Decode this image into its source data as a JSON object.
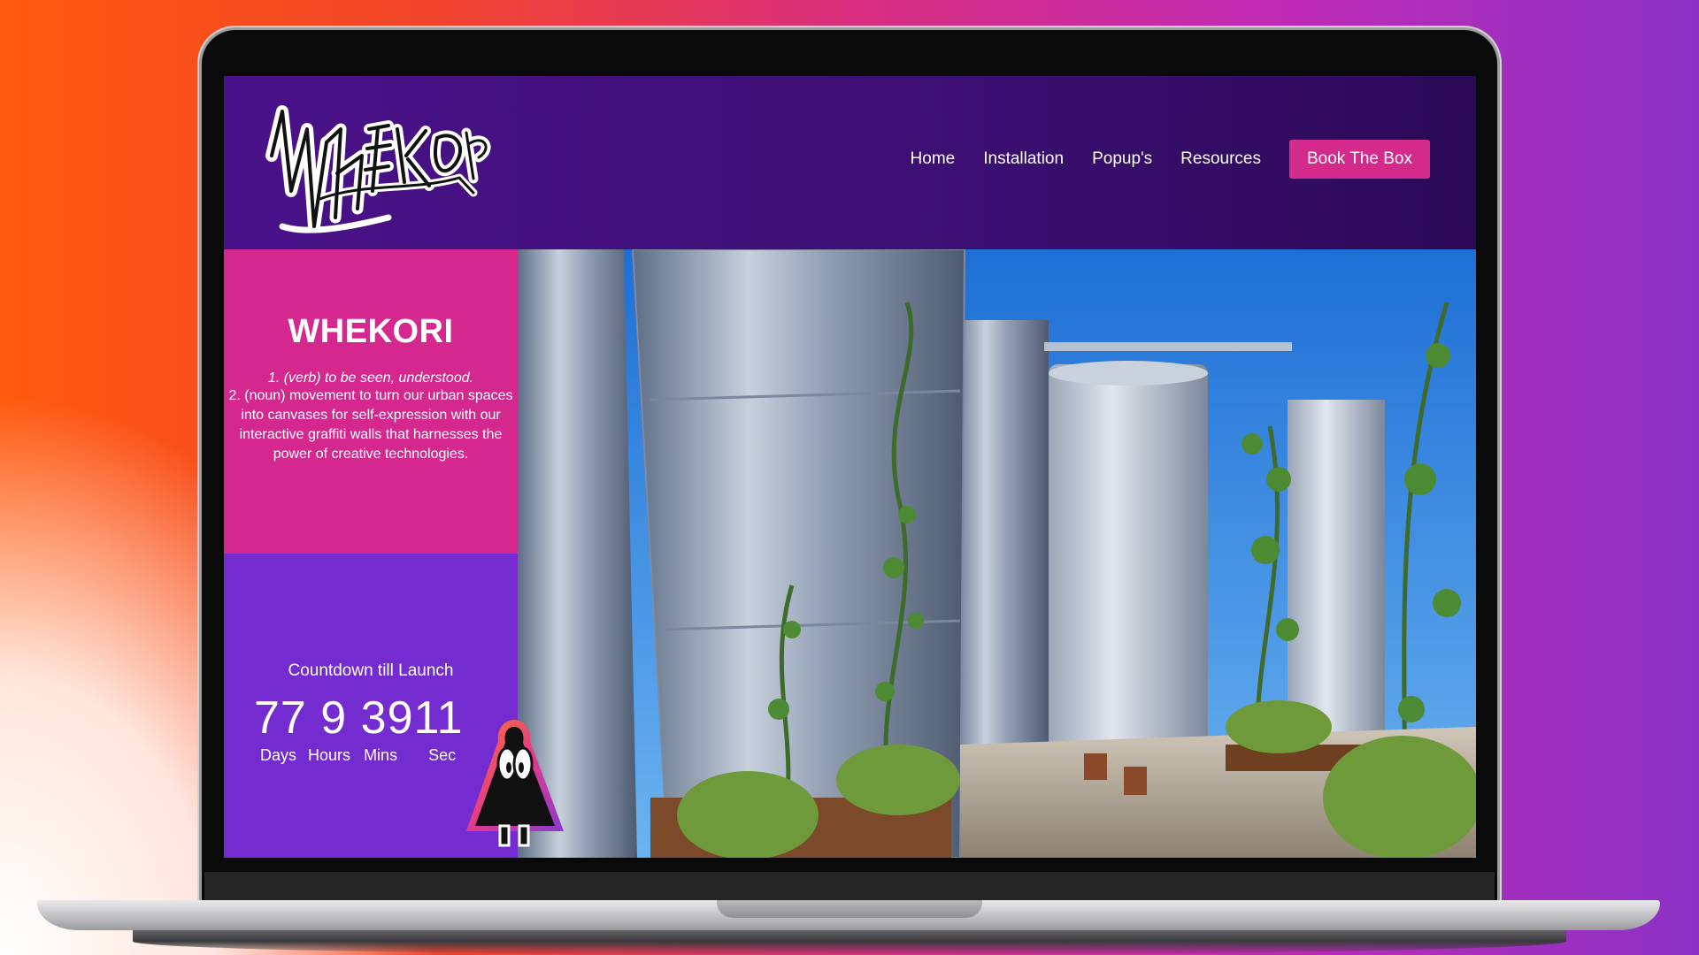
{
  "site": {
    "logo_text": "WHEKORI"
  },
  "nav": {
    "items": [
      "Home",
      "Installation",
      "Popup's",
      "Resources"
    ],
    "cta_label": "Book The Box"
  },
  "info": {
    "title": "WHEKORI",
    "definition_1": "1. (verb) to be seen, understood.",
    "definition_2": "2. (noun) movement to turn our urban spaces into canvases for self-expression with our interactive graffiti walls that harnesses the power of creative technologies."
  },
  "countdown": {
    "title": "Countdown till Launch",
    "days": "77",
    "hours": "9",
    "mins": "39",
    "secs": "11",
    "labels": {
      "days": "Days",
      "hours": "Hours",
      "mins": "Mins",
      "secs": "Sec"
    }
  },
  "colors": {
    "header_bg": "#3d0f74",
    "cta_bg": "#d42a8c",
    "info_bg": "#d4288e",
    "countdown_bg": "#742bd0"
  },
  "icons": {
    "mascot": "mascot-icon",
    "logo": "graffiti-logo"
  }
}
